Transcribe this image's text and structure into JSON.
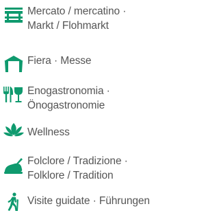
{
  "colors": {
    "icon": "#0f9a6e",
    "text": "#555555"
  },
  "legend": {
    "items": [
      {
        "icon": "market-stall-icon",
        "lines": [
          "Mercato / mercatino ·",
          "Markt / Flohmarkt"
        ]
      },
      {
        "icon": "fair-tent-icon",
        "lines": [
          "Fiera · Messe"
        ]
      },
      {
        "icon": "cutlery-glass-icon",
        "lines": [
          "Enogastronomia ·",
          "Önogastronomie"
        ]
      },
      {
        "icon": "lotus-icon",
        "lines": [
          "Wellness"
        ]
      },
      {
        "icon": "folklore-hat-icon",
        "lines": [
          "Folclore / Tradizione ·",
          "Folklore / Tradition"
        ]
      },
      {
        "icon": "hiker-icon",
        "lines": [
          "Visite guidate · Führungen"
        ]
      }
    ]
  }
}
